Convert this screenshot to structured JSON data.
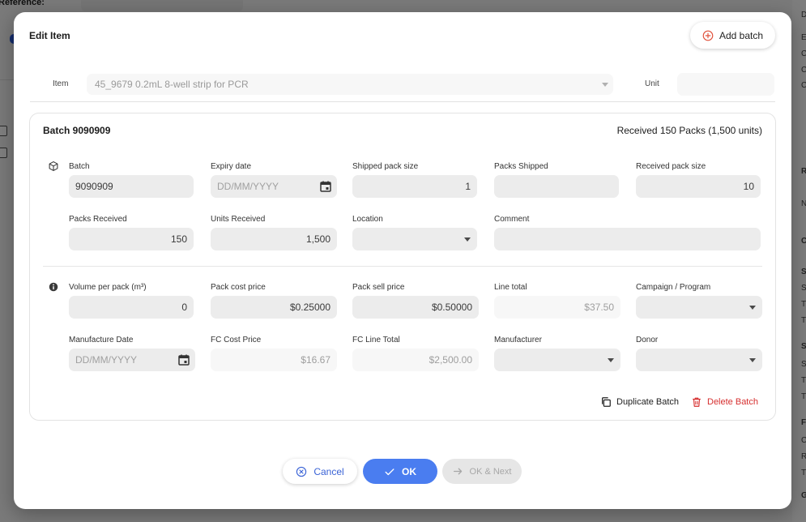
{
  "background": {
    "reference_label": "Reference:",
    "right_letters": [
      "D",
      "E",
      "C",
      "C",
      "C",
      "R",
      "N",
      "C",
      "S",
      "S",
      "T",
      "T",
      "S",
      "S",
      "T",
      "T",
      "F",
      "C",
      "R",
      "T",
      "G"
    ]
  },
  "modal": {
    "title": "Edit Item",
    "add_batch_label": "Add batch",
    "item_label": "Item",
    "item_value": "45_9679 0.2mL 8-well strip for PCR",
    "unit_label": "Unit",
    "unit_value": ""
  },
  "batch": {
    "title": "Batch 9090909",
    "received_summary": "Received 150 Packs (1,500 units)",
    "fields": {
      "batch": {
        "label": "Batch",
        "value": "9090909"
      },
      "expiry_date": {
        "label": "Expiry date",
        "placeholder": "DD/MM/YYYY"
      },
      "shipped_pack_size": {
        "label": "Shipped pack size",
        "value": "1"
      },
      "packs_shipped": {
        "label": "Packs Shipped",
        "value": ""
      },
      "received_pack_size": {
        "label": "Received pack size",
        "value": "10"
      },
      "packs_received": {
        "label": "Packs Received",
        "value": "150"
      },
      "units_received": {
        "label": "Units Received",
        "value": "1,500"
      },
      "location": {
        "label": "Location",
        "value": ""
      },
      "comment": {
        "label": "Comment",
        "value": ""
      },
      "volume_per_pack": {
        "label": "Volume per pack (m³)",
        "value": "0"
      },
      "pack_cost_price": {
        "label": "Pack cost price",
        "value": "$0.25000"
      },
      "pack_sell_price": {
        "label": "Pack sell price",
        "value": "$0.50000"
      },
      "line_total": {
        "label": "Line total",
        "value": "$37.50"
      },
      "campaign_program": {
        "label": "Campaign / Program",
        "value": ""
      },
      "manufacture_date": {
        "label": "Manufacture Date",
        "placeholder": "DD/MM/YYYY"
      },
      "fc_cost_price": {
        "label": "FC Cost Price",
        "value": "$16.67"
      },
      "fc_line_total": {
        "label": "FC Line Total",
        "value": "$2,500.00"
      },
      "manufacturer": {
        "label": "Manufacturer",
        "value": ""
      },
      "donor": {
        "label": "Donor",
        "value": ""
      }
    },
    "duplicate_label": "Duplicate Batch",
    "delete_label": "Delete Batch"
  },
  "footer": {
    "cancel_label": "Cancel",
    "ok_label": "OK",
    "ok_next_label": "OK & Next"
  },
  "colors": {
    "primary": "#4a7df0",
    "danger": "#d62f2f",
    "add_icon": "#e0503a"
  },
  "icons": [
    "plus-circle-icon",
    "package-icon",
    "info-icon",
    "calendar-icon",
    "copy-icon",
    "trash-icon",
    "x-circle-icon",
    "check-icon",
    "arrow-right-icon",
    "chevron-down-icon"
  ]
}
